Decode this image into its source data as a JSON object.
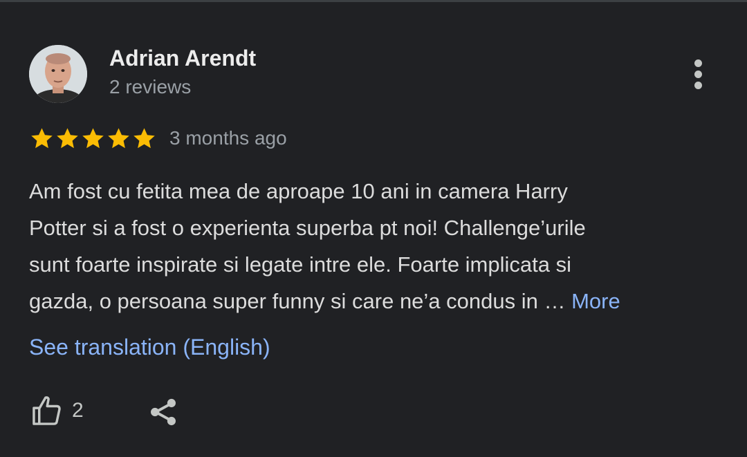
{
  "review": {
    "author": {
      "name": "Adrian Arendt",
      "reviews": "2 reviews"
    },
    "rating": 5,
    "rating_max": 5,
    "time": "3 months ago",
    "text_lines": [
      "Am fost cu fetita mea de aproape 10 ani in camera Harry",
      "Potter si a fost o experienta superba pt noi! Challenge’urile",
      "sunt foarte inspirate si legate intre ele. Foarte implicata si",
      "gazda, o persoana super funny si care ne’a condus in … "
    ],
    "more_label": "More",
    "translate_label": "See translation (English)",
    "likes": "2"
  },
  "colors": {
    "background": "#202124",
    "star": "#fbbc04",
    "link": "#8ab4f8",
    "muted": "#9aa0a6"
  },
  "icons": {
    "menu": "more-vert-icon",
    "like": "thumb-up-icon",
    "share": "share-icon",
    "star": "star-icon"
  }
}
